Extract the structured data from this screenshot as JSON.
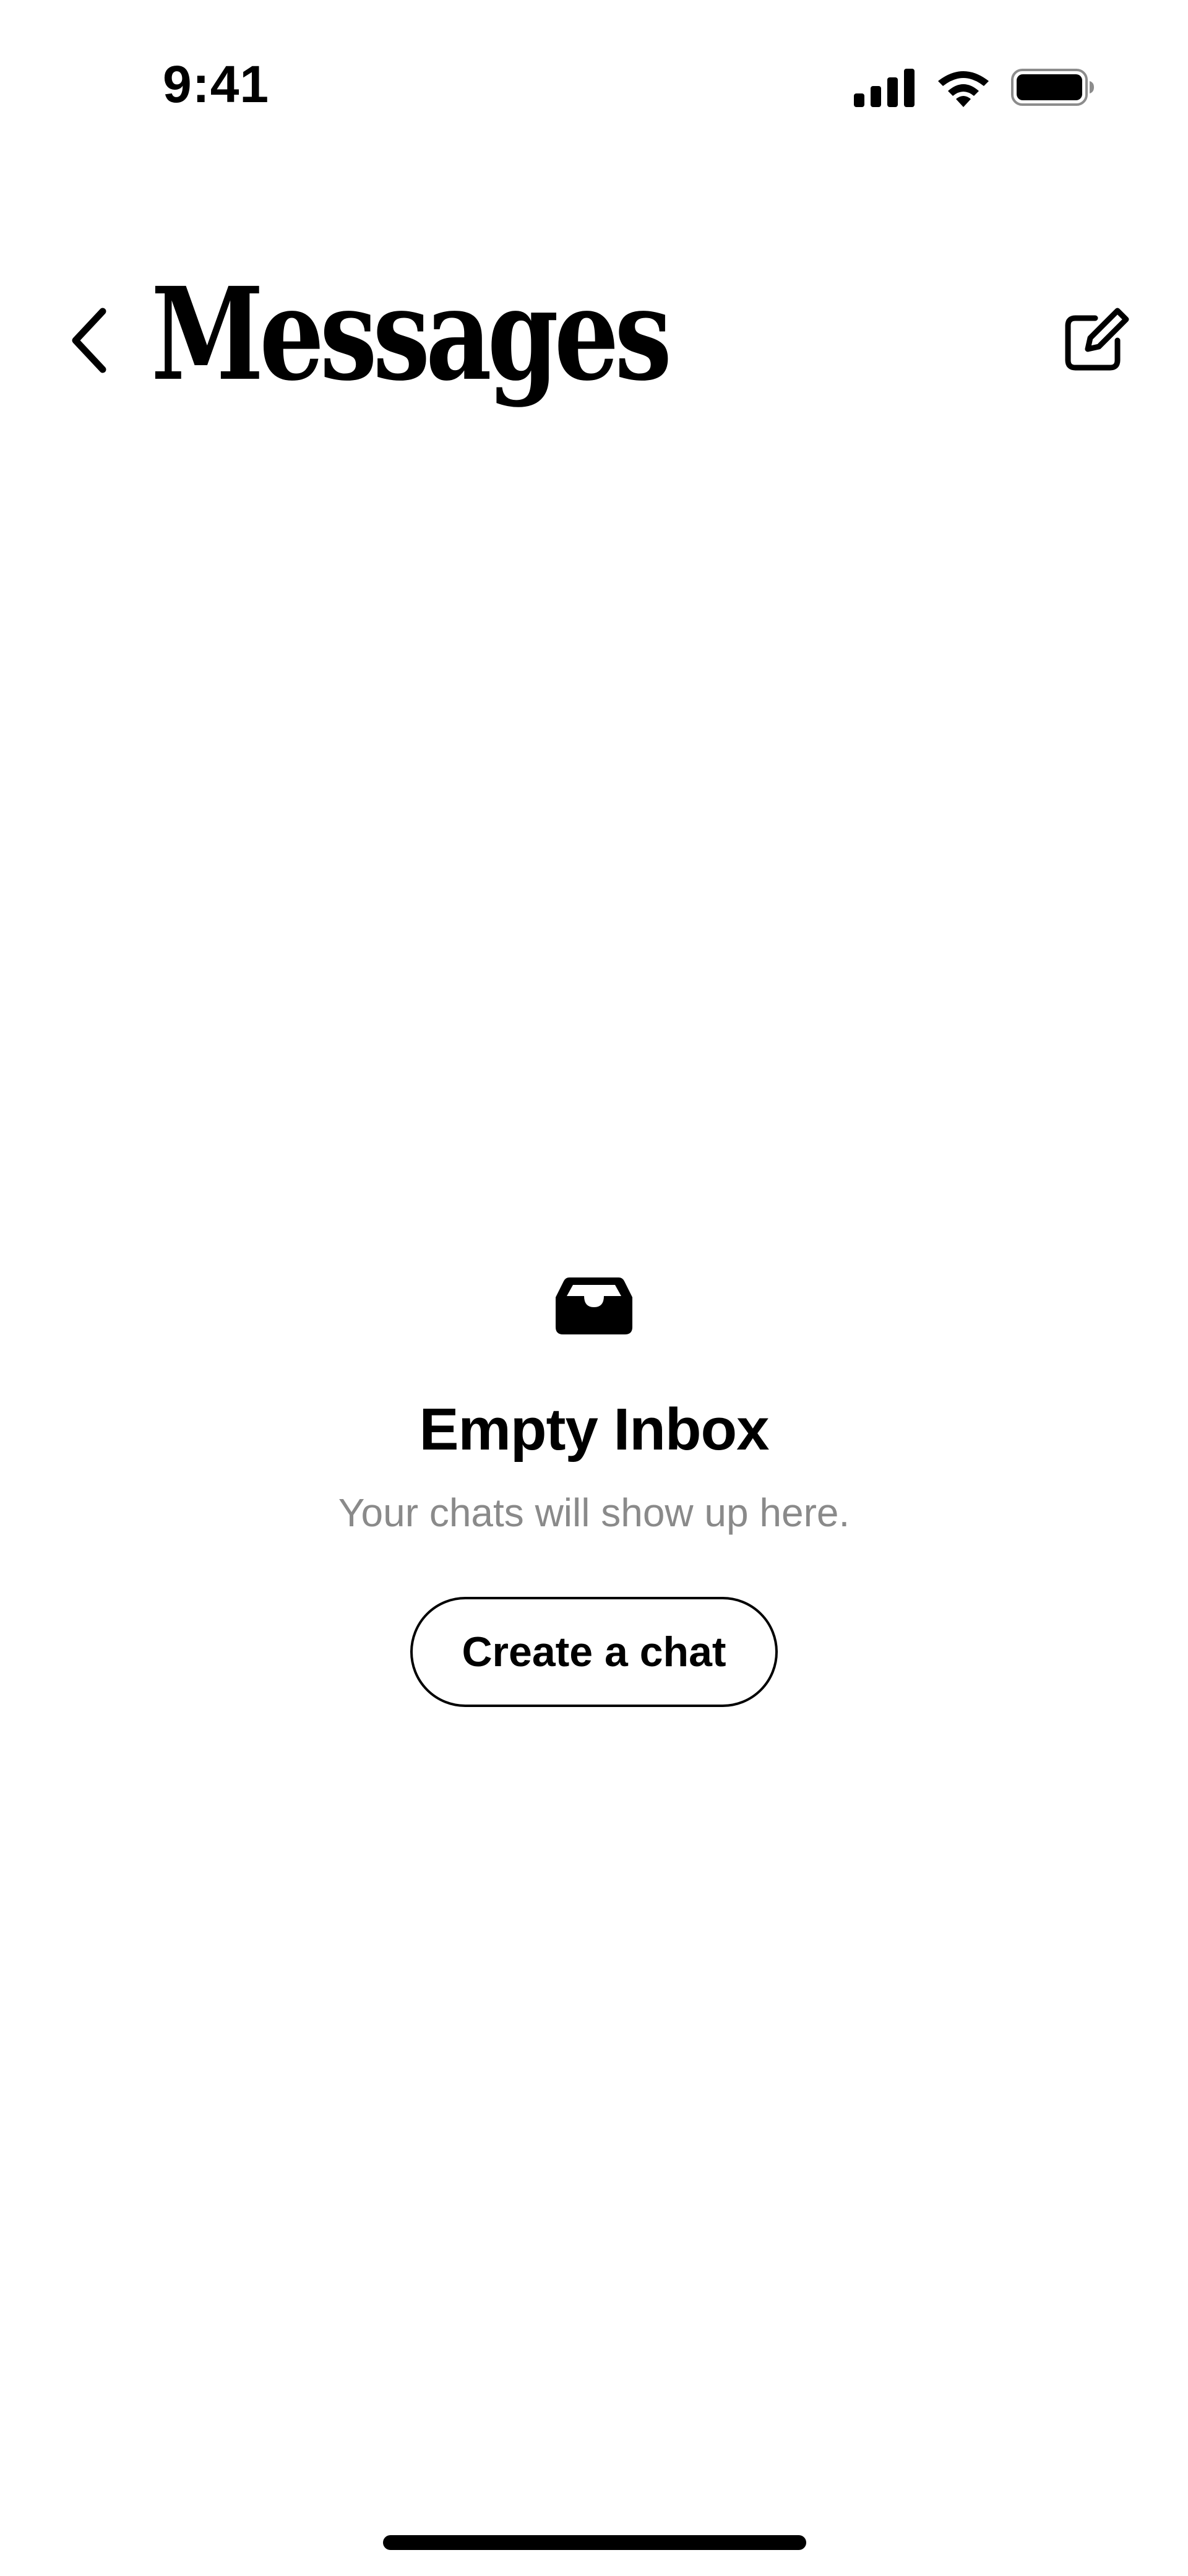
{
  "status_bar": {
    "time": "9:41",
    "icons": [
      "cellular-signal-icon",
      "wifi-icon",
      "battery-icon"
    ]
  },
  "header": {
    "back_icon": "chevron-left-icon",
    "title": "Messages",
    "compose_icon": "compose-icon"
  },
  "empty_state": {
    "icon": "inbox-icon",
    "title": "Empty Inbox",
    "subtitle": "Your chats will show up here.",
    "button_label": "Create a chat"
  },
  "colors": {
    "background": "#ffffff",
    "text": "#000000",
    "subtitle": "#8a8a8a"
  }
}
